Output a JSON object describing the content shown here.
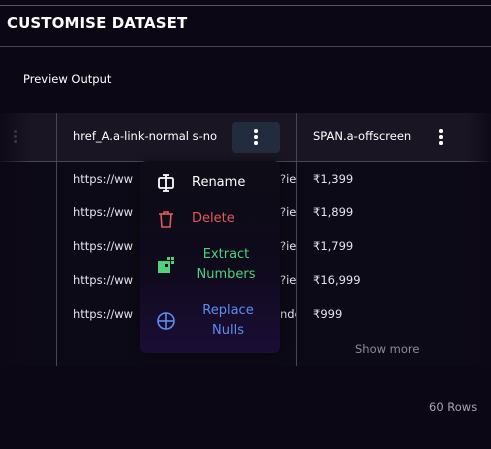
{
  "dialog": {
    "title": "CUSTOMISE DATASET",
    "section_label": "Preview Output"
  },
  "table": {
    "columns": [
      {
        "header": "href_A.a-link-normal s-no"
      },
      {
        "header": "SPAN.a-offscreen"
      }
    ],
    "rows": [
      {
        "url_start": "https://ww",
        "url_end": "?ie",
        "price": "₹1,399"
      },
      {
        "url_start": "https://ww",
        "url_end": "?ie",
        "price": "₹1,899"
      },
      {
        "url_start": "https://ww",
        "url_end": "?ie",
        "price": "₹1,799"
      },
      {
        "url_start": "https://ww",
        "url_end": "?ie",
        "price": "₹16,999"
      },
      {
        "url_start": "https://ww",
        "url_end": "nde",
        "price": "₹999"
      }
    ],
    "show_more": "Show more",
    "row_count": "60 Rows"
  },
  "menu": {
    "items": [
      {
        "label": "Rename",
        "icon": "rename-icon",
        "color": "#ffffff"
      },
      {
        "label": "Delete",
        "icon": "trash-icon",
        "color": "#e05a5a"
      },
      {
        "label_line1": "Extract",
        "label_line2": "Numbers",
        "icon": "extract-numbers-icon",
        "color": "#4fd27a"
      },
      {
        "label_line1": "Replace",
        "label_line2": "Nulls",
        "icon": "replace-nulls-icon",
        "color": "#5b8ef0"
      }
    ]
  },
  "colors": {
    "background": "#0c0714",
    "header_bg": "#191523",
    "active_kebab_bg": "#232c3c",
    "divider": "#4a4458"
  }
}
